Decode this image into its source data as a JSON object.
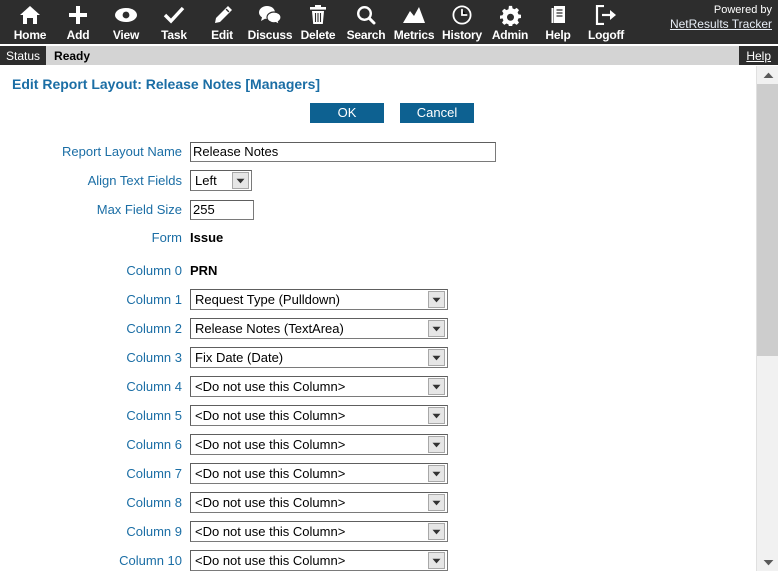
{
  "toolbar": {
    "items": [
      {
        "label": "Home",
        "icon": "home-icon"
      },
      {
        "label": "Add",
        "icon": "plus-icon"
      },
      {
        "label": "View",
        "icon": "eye-icon"
      },
      {
        "label": "Task",
        "icon": "check-icon"
      },
      {
        "label": "Edit",
        "icon": "pencil-icon"
      },
      {
        "label": "Discuss",
        "icon": "speech-bubbles-icon"
      },
      {
        "label": "Delete",
        "icon": "trash-icon"
      },
      {
        "label": "Search",
        "icon": "magnifier-icon"
      },
      {
        "label": "Metrics",
        "icon": "chart-line-icon"
      },
      {
        "label": "History",
        "icon": "clock-icon"
      },
      {
        "label": "Admin",
        "icon": "gear-icon"
      },
      {
        "label": "Help",
        "icon": "document-icon"
      },
      {
        "label": "Logoff",
        "icon": "logout-arrow-icon"
      }
    ],
    "powered_by_label": "Powered by",
    "powered_by_link": "NetResults Tracker"
  },
  "statusbar": {
    "tag": "Status",
    "text": "Ready",
    "help_link": "Help"
  },
  "page": {
    "title": "Edit Report Layout: Release Notes [Managers]",
    "ok_label": "OK",
    "cancel_label": "Cancel"
  },
  "form": {
    "report_layout_name_label": "Report Layout Name",
    "report_layout_name_value": "Release Notes",
    "align_text_fields_label": "Align Text Fields",
    "align_text_fields_value": "Left",
    "max_field_size_label": "Max Field Size",
    "max_field_size_value": "255",
    "form_label": "Form",
    "form_value": "Issue",
    "column0_label": "Column 0",
    "column0_value": "PRN",
    "columns": [
      {
        "label": "Column 1",
        "value": "Request Type  (Pulldown)"
      },
      {
        "label": "Column 2",
        "value": "Release Notes  (TextArea)"
      },
      {
        "label": "Column 3",
        "value": "Fix Date  (Date)"
      },
      {
        "label": "Column 4",
        "value": "<Do not use this Column>"
      },
      {
        "label": "Column 5",
        "value": "<Do not use this Column>"
      },
      {
        "label": "Column 6",
        "value": "<Do not use this Column>"
      },
      {
        "label": "Column 7",
        "value": "<Do not use this Column>"
      },
      {
        "label": "Column 8",
        "value": "<Do not use this Column>"
      },
      {
        "label": "Column 9",
        "value": "<Do not use this Column>"
      },
      {
        "label": "Column 10",
        "value": "<Do not use this Column>"
      }
    ]
  },
  "colors": {
    "toolbar_bg": "#2d2d2d",
    "accent_blue": "#1b6ea5",
    "button_blue": "#0d6191",
    "status_bg": "#d4d4d4"
  }
}
